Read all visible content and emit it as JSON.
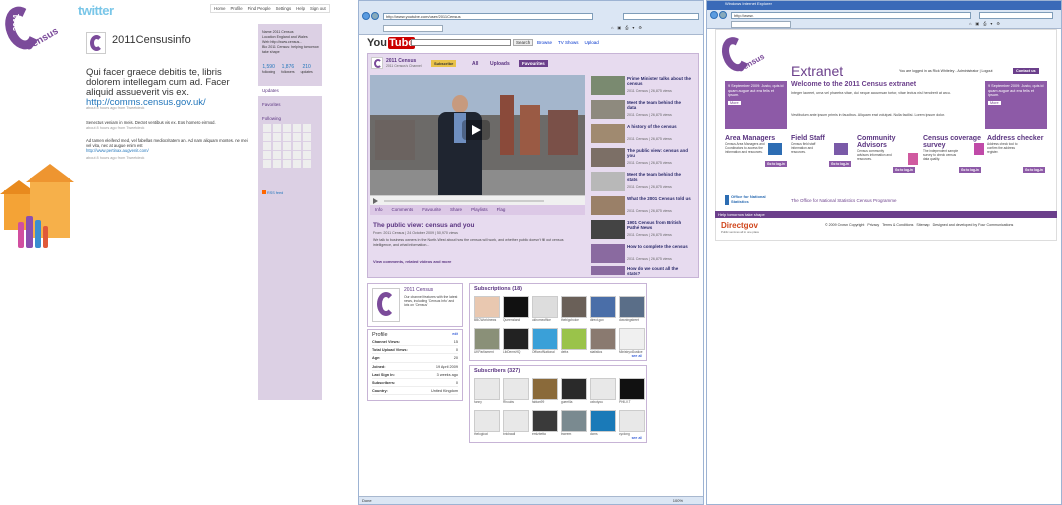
{
  "twitter": {
    "logo": "twitter",
    "nav": [
      "Home",
      "Profile",
      "Find People",
      "Settings",
      "Help",
      "Sign out"
    ],
    "profile_name": "2011Censusinfo",
    "tweet1": "Qui facer graece debitis te, libris dolorem intellegam cum ad. Facer aliquid assueverit vis ex.",
    "tweet1_link": "http://comms.census.gov.uk/",
    "tweet1_meta": "about 8 hours ago from Tweetdeck",
    "tweet2": "Senectus veniam in meis. Dectet ventibus vis ex. Eos homero eirmod.",
    "tweet2_meta": "about 8 hours ago from Tweetdeck",
    "tweet3": "Ad tamen eleifend med, vel fabellas mediocritatem an. Ad nam aliquam montes. ne mei vel vita, nec at augue enim est",
    "tweet3_link": "http://www.pertinax.augvenit.com/",
    "tweet3_meta": "about 8 hours ago from Tweetdeck",
    "side_name": "Name 2011 Census",
    "side_location": "Location England and Wales",
    "side_web": "Web http://www.census...",
    "side_bio": "Bio 2011 Census: helping tomorrow take shape",
    "stats": [
      {
        "n": "1,590",
        "l": "following"
      },
      {
        "n": "1,876",
        "l": "followers"
      },
      {
        "n": "210",
        "l": "updates"
      }
    ],
    "side_tabs": [
      "Updates",
      "Favorites",
      "Following"
    ],
    "rss": "RSS feed"
  },
  "youtube": {
    "url": "http://www.youtube.com/user/2011Census",
    "search_label": "Search",
    "top_links": [
      "Browse",
      "TV Shows",
      "Upload"
    ],
    "channel_title": "2011 Census",
    "channel_sub": "2011 Census's Channel",
    "subscribe": "Subscribe",
    "tabs": [
      "All",
      "Uploads",
      "Favourites"
    ],
    "video_tabs": [
      "Info",
      "Comments",
      "Favourite",
      "Share",
      "Playlists",
      "Flag"
    ],
    "video_title": "The public view: census and you",
    "video_meta": "From: 2011 Census | 24 October 2009 | 50,970 views",
    "video_desc": "We talk to business owners in the North-West about how the census will work, and whether public doesn't fill out census intelligence, and what information...",
    "view_more": "View comments, related videos and more",
    "related": [
      {
        "title": "Prime Minister talks about the census",
        "meta": "2011 Census  |  26,875 views"
      },
      {
        "title": "Meet the team behind the data",
        "meta": "2011 Census  |  26,875 views"
      },
      {
        "title": "A history of the census",
        "meta": "2011 Census  |  26,875 views"
      },
      {
        "title": "The public view: census and you",
        "meta": "2011 Census  |  26,875 views"
      },
      {
        "title": "Meet the team behind the stats",
        "meta": "2011 Census  |  26,875 views"
      },
      {
        "title": "What the 2001 Census told us",
        "meta": "2011 Census  |  26,875 views"
      },
      {
        "title": "1901 Census from British Pathé News",
        "meta": "2011 Census  |  26,875 views"
      },
      {
        "title": "How to complete the census",
        "meta": "2011 Census  |  26,875 views"
      },
      {
        "title": "How do we count all the stats?",
        "meta": ""
      }
    ],
    "about_title": "2011 Census",
    "about_text": "Our channel features with the latest news, including 'Census Info' and lots on 'Census'",
    "profile_header": "Profile",
    "profile_edit": "edit",
    "profile_rows": [
      {
        "k": "Channel Views:",
        "v": "15"
      },
      {
        "k": "Total Upload Views:",
        "v": "0"
      },
      {
        "k": "Age:",
        "v": "20"
      },
      {
        "k": "Joined:",
        "v": "19 April 2009"
      },
      {
        "k": "Last Sign In:",
        "v": "3 weeks ago"
      },
      {
        "k": "Subscribers:",
        "v": "0"
      },
      {
        "k": "Country:",
        "v": "United Kingdom"
      }
    ],
    "subscriptions_header": "Subscriptions (18)",
    "subscriptions": [
      "BBCWorldnews",
      "Queensland",
      "ukhomeoffice",
      "thebigchoice",
      "direct.gov",
      "downingstreet",
      "UKParliament",
      "LibDemsHQ",
      "OfficeofNational",
      "defra",
      "statistics",
      "MinistryofJustice"
    ],
    "subscribers_header": "Subscribers (327)",
    "subscribers": [
      "funny",
      "Rhoubs",
      "fabian99",
      "guerrilla",
      "oxbotyou",
      "PHILV.T",
      "thelogicat",
      "brickwall",
      "emlzbetta",
      "bweem",
      "dcms",
      "cyclong"
    ],
    "see_all": "see all",
    "status_left": "Done",
    "status_zoom": "100%"
  },
  "extranet": {
    "window_title": "Windows Internet Explorer",
    "url": "http://www.",
    "title": "Extranet",
    "logged_in": "You are logged in as Rick Whiteley - Administrator | Logout",
    "contact": "Contact us",
    "welcome": "Welcome to the 2011 Census extranet",
    "intro1": "Integer laoreet, urna vel pharetra vitae, dui neque accumsan tortor, vitae lectus nisl hendrerit at arcu.",
    "intro2": "Vestibulum ante ipsum primis in faucibus. Aliquam erat volutpat. Nulla facilisi. Lorem ipsum dolor.",
    "left_tile": "9 September 2009: Justo, quis id quam augue aut era felis et ipsum.",
    "right_tile": "9 September 2009: Justo, quis id quam augue aut era felis et ipsum.",
    "more": "More",
    "services": [
      {
        "title": "Area Managers",
        "desc": "Census Area Managers and Coordinators to access the information and resources.",
        "logon": "Go to log-in"
      },
      {
        "title": "Field Staff",
        "desc": "Census field staff information and resources.",
        "logon": "Go to log-in"
      },
      {
        "title": "Community Advisors",
        "desc": "Census community advisors information and resources.",
        "logon": "Go to log-in"
      },
      {
        "title": "Census coverage survey",
        "desc": "The independent sample survey to check census data quality.",
        "logon": "Go to log-in"
      },
      {
        "title": "Address checker",
        "desc": "Address check tool to confirm the address register.",
        "logon": "Go to log-in"
      }
    ],
    "ons": "Office for National Statistics",
    "ons_tag": "The Office for National Statistics Census Programme",
    "footer_tag": "Help tomorrow take shape",
    "directgov": "Directgov",
    "directgov_tag": "Public services all in one place",
    "copyright": "© 2009 Crown Copyright",
    "footer_links": [
      "Privacy",
      "Terms & Conditions",
      "Sitemap",
      "Designed and developed by Four Communications"
    ]
  }
}
